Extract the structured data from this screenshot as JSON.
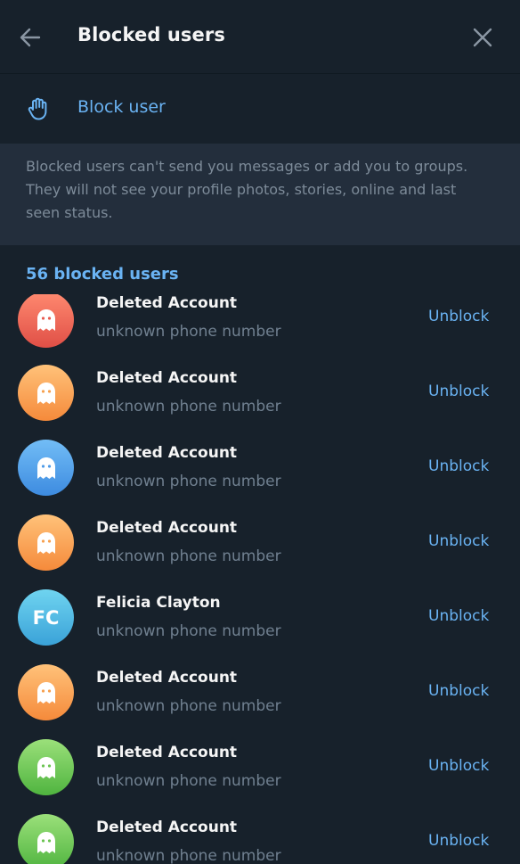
{
  "header": {
    "title": "Blocked users"
  },
  "block_action": {
    "label": "Block user"
  },
  "info": {
    "text": "Blocked users can't send you messages or add you to groups. They will not see your profile photos, stories, online and last seen status."
  },
  "list": {
    "count_label": "56 blocked users",
    "unblock_label": "Unblock",
    "users": [
      {
        "name": "Deleted Account",
        "phone": "unknown phone number",
        "avatar_color": "red",
        "avatar": "ghost-icon"
      },
      {
        "name": "Deleted Account",
        "phone": "unknown phone number",
        "avatar_color": "orange",
        "avatar": "ghost-icon"
      },
      {
        "name": "Deleted Account",
        "phone": "unknown phone number",
        "avatar_color": "blue",
        "avatar": "ghost-icon"
      },
      {
        "name": "Deleted Account",
        "phone": "unknown phone number",
        "avatar_color": "orange",
        "avatar": "ghost-icon"
      },
      {
        "name": "Felicia Clayton",
        "phone": "unknown phone number",
        "avatar_color": "cyan",
        "initials": "FC"
      },
      {
        "name": "Deleted Account",
        "phone": "unknown phone number",
        "avatar_color": "orange",
        "avatar": "ghost-icon"
      },
      {
        "name": "Deleted Account",
        "phone": "unknown phone number",
        "avatar_color": "green",
        "avatar": "ghost-icon"
      },
      {
        "name": "Deleted Account",
        "phone": "unknown phone number",
        "avatar_color": "green",
        "avatar": "ghost-icon"
      }
    ]
  },
  "colors": {
    "background": "#17212b",
    "info_background": "#232e3c",
    "accent": "#6ab3f3",
    "secondary_text": "#708090"
  }
}
